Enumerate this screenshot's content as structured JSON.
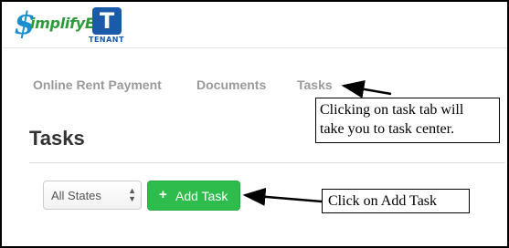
{
  "logo": {
    "dollar": "$",
    "text": "implifyEm",
    "badge_letter": "T",
    "sub": "TENANT"
  },
  "nav": {
    "items": [
      {
        "label": "Online Rent Payment"
      },
      {
        "label": "Documents"
      },
      {
        "label": "Tasks"
      }
    ]
  },
  "page": {
    "title": "Tasks"
  },
  "toolbar": {
    "state_select": "All States",
    "add_task_plus": "+",
    "add_task_label": "Add Task"
  },
  "annotations": {
    "tasks_callout_line1": "Clicking on task tab will",
    "tasks_callout_line2": "take you to task center.",
    "add_callout": "Click on Add Task"
  },
  "colors": {
    "accent_green": "#2ebd4d",
    "brand_blue": "#1b5aa8"
  }
}
